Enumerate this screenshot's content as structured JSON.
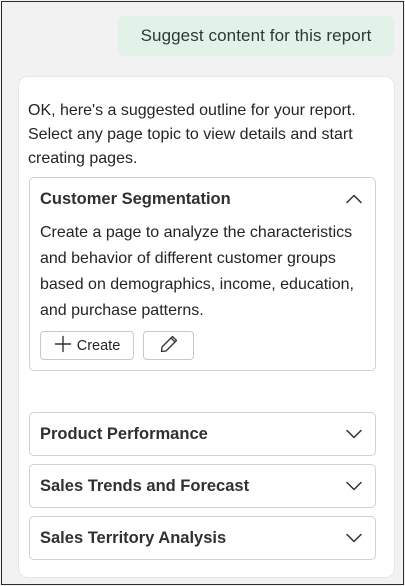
{
  "user_message": "Suggest content for this report",
  "response": {
    "intro": "OK, here's a suggested outline for your report. Select any page topic to view details and start creating pages.",
    "topics": [
      {
        "title": "Customer Segmentation",
        "expanded": true,
        "chevron_icon": "chevron-up-icon",
        "description": "Create a page to analyze the characteristics and behavior of different customer groups based on demographics, income, education, and purchase patterns.",
        "create_label": "Create",
        "create_icon": "plus-icon",
        "edit_icon": "pencil-icon"
      },
      {
        "title": "Product Performance",
        "expanded": false,
        "chevron_icon": "chevron-down-icon"
      },
      {
        "title": "Sales Trends and Forecast",
        "expanded": false,
        "chevron_icon": "chevron-down-icon"
      },
      {
        "title": "Sales Territory Analysis",
        "expanded": false,
        "chevron_icon": "chevron-down-icon"
      }
    ]
  },
  "colors": {
    "user_bubble_bg": "#e1f2e9",
    "card_bg": "#ffffff",
    "border": "#d1d1d1"
  }
}
